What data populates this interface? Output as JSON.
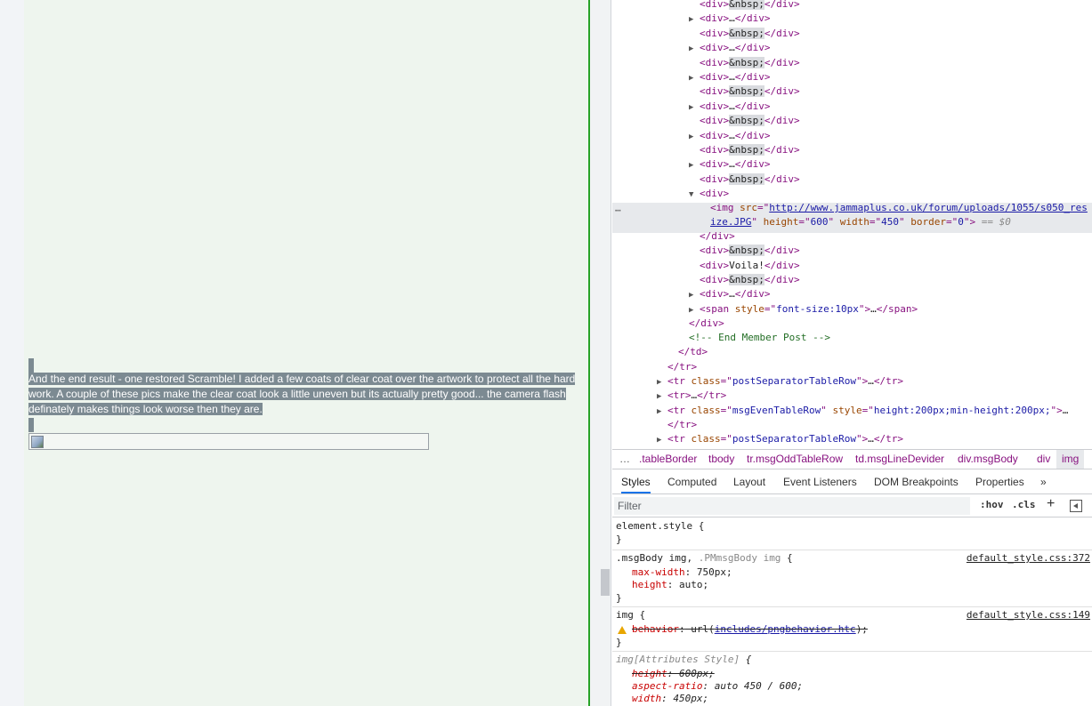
{
  "page": {
    "post_text": "And the end result - one restored Scramble! I added a few coats of clear coat over the artwork to protect all the hard work. A couple of these pics make the clear coat look a little uneven but its actually pretty good... the camera flash definately makes things look worse then they are."
  },
  "elements": {
    "lines": [
      {
        "indent": 786,
        "tri": "",
        "parts": [
          [
            "tag",
            "<div>"
          ],
          [
            "nbsp",
            "&nbsp;"
          ],
          [
            "tag",
            "</div>"
          ]
        ]
      },
      {
        "indent": 786,
        "tri": "▶",
        "parts": [
          [
            "tag",
            "<div>"
          ],
          [
            "txt",
            "…"
          ],
          [
            "tag",
            "</div>"
          ]
        ]
      },
      {
        "indent": 786,
        "tri": "",
        "parts": [
          [
            "tag",
            "<div>"
          ],
          [
            "nbsp",
            "&nbsp;"
          ],
          [
            "tag",
            "</div>"
          ]
        ]
      },
      {
        "indent": 786,
        "tri": "▶",
        "parts": [
          [
            "tag",
            "<div>"
          ],
          [
            "txt",
            "…"
          ],
          [
            "tag",
            "</div>"
          ]
        ]
      },
      {
        "indent": 786,
        "tri": "",
        "parts": [
          [
            "tag",
            "<div>"
          ],
          [
            "nbsp",
            "&nbsp;"
          ],
          [
            "tag",
            "</div>"
          ]
        ]
      },
      {
        "indent": 786,
        "tri": "▶",
        "parts": [
          [
            "tag",
            "<div>"
          ],
          [
            "txt",
            "…"
          ],
          [
            "tag",
            "</div>"
          ]
        ]
      },
      {
        "indent": 786,
        "tri": "",
        "parts": [
          [
            "tag",
            "<div>"
          ],
          [
            "nbsp",
            "&nbsp;"
          ],
          [
            "tag",
            "</div>"
          ]
        ]
      },
      {
        "indent": 786,
        "tri": "▶",
        "parts": [
          [
            "tag",
            "<div>"
          ],
          [
            "txt",
            "…"
          ],
          [
            "tag",
            "</div>"
          ]
        ]
      },
      {
        "indent": 786,
        "tri": "",
        "parts": [
          [
            "tag",
            "<div>"
          ],
          [
            "nbsp",
            "&nbsp;"
          ],
          [
            "tag",
            "</div>"
          ]
        ]
      },
      {
        "indent": 786,
        "tri": "▶",
        "parts": [
          [
            "tag",
            "<div>"
          ],
          [
            "txt",
            "…"
          ],
          [
            "tag",
            "</div>"
          ]
        ]
      },
      {
        "indent": 786,
        "tri": "",
        "parts": [
          [
            "tag",
            "<div>"
          ],
          [
            "nbsp",
            "&nbsp;"
          ],
          [
            "tag",
            "</div>"
          ]
        ]
      },
      {
        "indent": 786,
        "tri": "▶",
        "parts": [
          [
            "tag",
            "<div>"
          ],
          [
            "txt",
            "…"
          ],
          [
            "tag",
            "</div>"
          ]
        ]
      },
      {
        "indent": 786,
        "tri": "",
        "parts": [
          [
            "tag",
            "<div>"
          ],
          [
            "nbsp",
            "&nbsp;"
          ],
          [
            "tag",
            "</div>"
          ]
        ]
      },
      {
        "indent": 786,
        "tri": "▼",
        "parts": [
          [
            "tag",
            "<div>"
          ]
        ]
      }
    ],
    "selected_line1": [
      [
        "tag",
        "<img "
      ],
      [
        "attr",
        "src"
      ],
      [
        "tag",
        "=\""
      ],
      [
        "link",
        "http://www.jammaplus.co.uk/forum/uploads/1055/s050_res"
      ]
    ],
    "selected_line2": [
      [
        "link",
        "ize.JPG"
      ],
      [
        "tag",
        "\" "
      ],
      [
        "attr",
        "height"
      ],
      [
        "tag",
        "=\""
      ],
      [
        "val",
        "600"
      ],
      [
        "tag",
        "\" "
      ],
      [
        "attr",
        "width"
      ],
      [
        "tag",
        "=\""
      ],
      [
        "val",
        "450"
      ],
      [
        "tag",
        "\" "
      ],
      [
        "attr",
        "border"
      ],
      [
        "tag",
        "=\""
      ],
      [
        "val",
        "0"
      ],
      [
        "tag",
        "\">"
      ],
      [
        "dollar",
        " == $0"
      ]
    ],
    "lines_after": [
      {
        "indent": 786,
        "tri": "",
        "parts": [
          [
            "tag",
            "</div>"
          ]
        ]
      },
      {
        "indent": 786,
        "tri": "",
        "parts": [
          [
            "tag",
            "<div>"
          ],
          [
            "nbsp",
            "&nbsp;"
          ],
          [
            "tag",
            "</div>"
          ]
        ]
      },
      {
        "indent": 786,
        "tri": "",
        "parts": [
          [
            "tag",
            "<div>"
          ],
          [
            "txt",
            "Voila!"
          ],
          [
            "tag",
            "</div>"
          ]
        ]
      },
      {
        "indent": 786,
        "tri": "",
        "parts": [
          [
            "tag",
            "<div>"
          ],
          [
            "nbsp",
            "&nbsp;"
          ],
          [
            "tag",
            "</div>"
          ]
        ]
      },
      {
        "indent": 786,
        "tri": "▶",
        "parts": [
          [
            "tag",
            "<div>"
          ],
          [
            "txt",
            "…"
          ],
          [
            "tag",
            "</div>"
          ]
        ]
      },
      {
        "indent": 786,
        "tri": "▶",
        "parts": [
          [
            "tag",
            "<span "
          ],
          [
            "attr",
            "style"
          ],
          [
            "tag",
            "=\""
          ],
          [
            "val",
            "font-size:10px"
          ],
          [
            "tag",
            "\">"
          ],
          [
            "txt",
            "…"
          ],
          [
            "tag",
            "</span>"
          ]
        ]
      },
      {
        "indent": 774,
        "tri": "",
        "parts": [
          [
            "tag",
            "</div>"
          ]
        ]
      },
      {
        "indent": 774,
        "tri": "",
        "parts": [
          [
            "cmt",
            "<!-- End Member Post -->"
          ]
        ]
      },
      {
        "indent": 762,
        "tri": "",
        "parts": [
          [
            "tag",
            "</td>"
          ]
        ]
      },
      {
        "indent": 750,
        "tri": "",
        "parts": [
          [
            "tag",
            "</tr>"
          ]
        ]
      },
      {
        "indent": 750,
        "tri": "▶",
        "parts": [
          [
            "tag",
            "<tr "
          ],
          [
            "attr",
            "class"
          ],
          [
            "tag",
            "=\""
          ],
          [
            "val",
            "postSeparatorTableRow"
          ],
          [
            "tag",
            "\">"
          ],
          [
            "txt",
            "…"
          ],
          [
            "tag",
            "</tr>"
          ]
        ]
      },
      {
        "indent": 750,
        "tri": "▶",
        "parts": [
          [
            "tag",
            "<tr>"
          ],
          [
            "txt",
            "…"
          ],
          [
            "tag",
            "</tr>"
          ]
        ]
      },
      {
        "indent": 750,
        "tri": "▶",
        "parts": [
          [
            "tag",
            "<tr "
          ],
          [
            "attr",
            "class"
          ],
          [
            "tag",
            "=\""
          ],
          [
            "val",
            "msgEvenTableRow"
          ],
          [
            "tag",
            "\" "
          ],
          [
            "attr",
            "style"
          ],
          [
            "tag",
            "=\""
          ],
          [
            "val",
            "height:200px;min-height:200px;"
          ],
          [
            "tag",
            "\">"
          ],
          [
            "txt",
            "…"
          ]
        ]
      },
      {
        "indent": 750,
        "tri": "",
        "parts": [
          [
            "tag",
            "</tr>"
          ]
        ]
      },
      {
        "indent": 750,
        "tri": "▶",
        "parts": [
          [
            "tag",
            "<tr "
          ],
          [
            "attr",
            "class"
          ],
          [
            "tag",
            "=\""
          ],
          [
            "val",
            "postSeparatorTableRow"
          ],
          [
            "tag",
            "\">"
          ],
          [
            "txt",
            "…"
          ],
          [
            "tag",
            "</tr>"
          ]
        ]
      }
    ]
  },
  "breadcrumbs": [
    ".tableBorder",
    "tbody",
    "tr.msgOddTableRow",
    "td.msgLineDevider",
    "div.msgBody",
    "div",
    "img"
  ],
  "breadcrumb_more": "…",
  "tabs": [
    "Styles",
    "Computed",
    "Layout",
    "Event Listeners",
    "DOM Breakpoints",
    "Properties"
  ],
  "tabs_more": "»",
  "filter": {
    "placeholder": "Filter",
    "hov": ":hov",
    "cls": ".cls",
    "plus": "+"
  },
  "styles": {
    "element_style": "element.style {",
    "close": "}",
    "rule1": {
      "selector_a": ".msgBody img, ",
      "selector_b": ".PMmsgBody img",
      "brace": " {",
      "source": "default_style.css:372",
      "props": [
        [
          "max-width",
          "750px;"
        ],
        [
          "height",
          "auto;"
        ]
      ]
    },
    "rule2": {
      "selector": "img {",
      "source": "default_style.css:149",
      "prop": "behavior",
      "value_pre": " url(",
      "link": "includes/pngbehavior.htc",
      "value_post": ");"
    },
    "rule3": {
      "selector": "img[Attributes Style]",
      "brace": " {",
      "props": [
        [
          "height",
          "600px;",
          true
        ],
        [
          "aspect-ratio",
          "auto 450 / 600;",
          false
        ],
        [
          "width",
          "450px;",
          false
        ]
      ]
    }
  },
  "colors": {
    "selection": "#7c8a92",
    "page_rule": "#27a327",
    "tab_active": "#1a73e8"
  }
}
